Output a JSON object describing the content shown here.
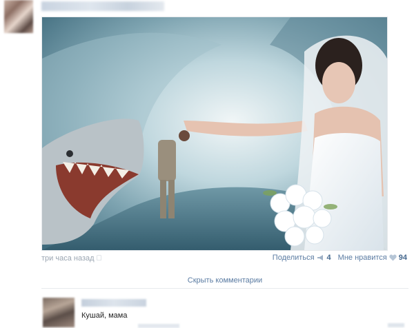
{
  "post": {
    "time": "три часа назад",
    "share_label": "Поделиться",
    "share_count": "4",
    "like_label": "Мне нравится",
    "like_count": "94"
  },
  "comments": {
    "hide_label": "Скрыть комментарии",
    "items": [
      {
        "text": "Кушай, мама"
      }
    ]
  }
}
